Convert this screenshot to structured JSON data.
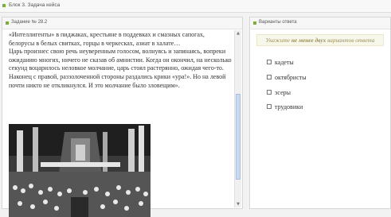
{
  "topbar": {
    "title": "Блок 3. Задача кейса"
  },
  "left_panel": {
    "header": "Задание № 28.2",
    "paragraph1": "«Интеллигенты» в пиджаках, крестьяне в поддевках и смазных сапогах, белорусы в белых свитках, горцы в черкесках, азиат в халате…",
    "paragraph2": "Царь произнес свою речь неуверенным голосом, волнуясь и запинаясь, вопреки ожиданию многих, ничего не сказав об амнистии. Когда он окончил, на несколько секунд воцарилось неловкое молчание, царь стоял растерянно, ожидая чего-то. Наконец с правой, раззолоченной стороны раздались крики «ура!». Но на левой почти никто не откликнулся. И это молчание было зловещим»."
  },
  "right_panel": {
    "header": "Варианты ответа",
    "hint_prefix": "Укажите",
    "hint_bold": "не менее двух",
    "hint_suffix": "вариантов ответа",
    "options": [
      "кадеты",
      "октябристы",
      "эсеры",
      "трудовики"
    ]
  },
  "icons": {
    "scroll_up": "triangle-up",
    "scroll_down": "triangle-down"
  },
  "colors": {
    "accent": "#7ab03a",
    "hint_text": "#9a8f5a",
    "hint_bg": "#f7f7ea",
    "scroll_thumb": "#c9d9ee"
  }
}
